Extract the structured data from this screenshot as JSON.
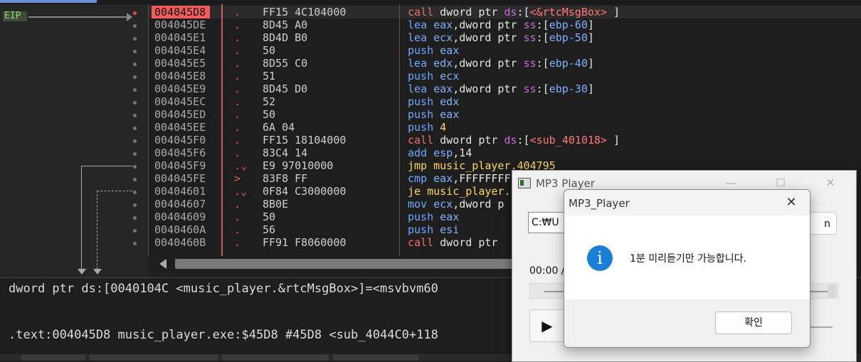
{
  "debugger": {
    "eip_label": "EIP",
    "rows": [
      {
        "addr": "004045D8",
        "mark": ".",
        "bytes": "FF15 4C104000",
        "mn": "call",
        "ops": [
          {
            "t": "dword ptr ",
            "c": "op"
          },
          {
            "t": "ds",
            "c": "seg"
          },
          {
            "t": ":[",
            "c": "op"
          },
          {
            "t": "<&rtcMsgBox>",
            "c": "tgt"
          },
          {
            "t": " ]",
            "c": "op"
          }
        ]
      },
      {
        "addr": "004045DE",
        "mark": ".",
        "bytes": "8D45 A0",
        "mn": "lea",
        "ops": [
          {
            "t": "eax",
            "c": "reg"
          },
          {
            "t": ",dword ptr ",
            "c": "op"
          },
          {
            "t": "ss",
            "c": "seg"
          },
          {
            "t": ":[",
            "c": "op"
          },
          {
            "t": "ebp-60",
            "c": "reg"
          },
          {
            "t": "]",
            "c": "op"
          }
        ]
      },
      {
        "addr": "004045E1",
        "mark": ".",
        "bytes": "8D4D B0",
        "mn": "lea",
        "ops": [
          {
            "t": "ecx",
            "c": "reg"
          },
          {
            "t": ",dword ptr ",
            "c": "op"
          },
          {
            "t": "ss",
            "c": "seg"
          },
          {
            "t": ":[",
            "c": "op"
          },
          {
            "t": "ebp-50",
            "c": "reg"
          },
          {
            "t": "]",
            "c": "op"
          }
        ]
      },
      {
        "addr": "004045E4",
        "mark": ".",
        "bytes": "50",
        "mn": "push",
        "ops": [
          {
            "t": "eax",
            "c": "reg"
          }
        ]
      },
      {
        "addr": "004045E5",
        "mark": ".",
        "bytes": "8D55 C0",
        "mn": "lea",
        "ops": [
          {
            "t": "edx",
            "c": "reg"
          },
          {
            "t": ",dword ptr ",
            "c": "op"
          },
          {
            "t": "ss",
            "c": "seg"
          },
          {
            "t": ":[",
            "c": "op"
          },
          {
            "t": "ebp-40",
            "c": "reg"
          },
          {
            "t": "]",
            "c": "op"
          }
        ]
      },
      {
        "addr": "004045E8",
        "mark": ".",
        "bytes": "51",
        "mn": "push",
        "ops": [
          {
            "t": "ecx",
            "c": "reg"
          }
        ]
      },
      {
        "addr": "004045E9",
        "mark": ".",
        "bytes": "8D45 D0",
        "mn": "lea",
        "ops": [
          {
            "t": "eax",
            "c": "reg"
          },
          {
            "t": ",dword ptr ",
            "c": "op"
          },
          {
            "t": "ss",
            "c": "seg"
          },
          {
            "t": ":[",
            "c": "op"
          },
          {
            "t": "ebp-30",
            "c": "reg"
          },
          {
            "t": "]",
            "c": "op"
          }
        ]
      },
      {
        "addr": "004045EC",
        "mark": ".",
        "bytes": "52",
        "mn": "push",
        "ops": [
          {
            "t": "edx",
            "c": "reg"
          }
        ]
      },
      {
        "addr": "004045ED",
        "mark": ".",
        "bytes": "50",
        "mn": "push",
        "ops": [
          {
            "t": "eax",
            "c": "reg"
          }
        ]
      },
      {
        "addr": "004045EE",
        "mark": ".",
        "bytes": "6A 04",
        "mn": "push",
        "ops": [
          {
            "t": "4",
            "c": "jmpc"
          }
        ]
      },
      {
        "addr": "004045F0",
        "mark": ".",
        "bytes": "FF15 18104000",
        "mn": "call",
        "ops": [
          {
            "t": "dword ptr ",
            "c": "op"
          },
          {
            "t": "ds",
            "c": "seg"
          },
          {
            "t": ":[",
            "c": "op"
          },
          {
            "t": "<sub_401018>",
            "c": "tgt"
          },
          {
            "t": " ]",
            "c": "op"
          }
        ]
      },
      {
        "addr": "004045F6",
        "mark": ".",
        "bytes": "83C4 14",
        "mn": "add",
        "ops": [
          {
            "t": "esp",
            "c": "reg"
          },
          {
            "t": ",14",
            "c": "op"
          }
        ]
      },
      {
        "addr": "004045F9",
        "mark": ".⌄",
        "bytes": "E9 97010000",
        "mn": "jmp",
        "ops": [
          {
            "t": "music_player.404795",
            "c": "jmpc"
          }
        ]
      },
      {
        "addr": "004045FE",
        "mark": ">",
        "bytes": "83F8 FF",
        "mn": "cmp",
        "ops": [
          {
            "t": "eax",
            "c": "reg"
          },
          {
            "t": ",FFFFFFFF",
            "c": "op"
          }
        ]
      },
      {
        "addr": "00404601",
        "mark": ".⌄",
        "bytes": "0F84 C3000000",
        "mn": "je",
        "ops": [
          {
            "t": "music_player.",
            "c": "jmpc"
          }
        ]
      },
      {
        "addr": "00404607",
        "mark": ".",
        "bytes": "8B0E",
        "mn": "mov",
        "ops": [
          {
            "t": "ecx",
            "c": "reg"
          },
          {
            "t": ",dword p",
            "c": "op"
          }
        ]
      },
      {
        "addr": "00404609",
        "mark": ".",
        "bytes": "50",
        "mn": "push",
        "ops": [
          {
            "t": "eax",
            "c": "reg"
          }
        ]
      },
      {
        "addr": "0040460A",
        "mark": ".",
        "bytes": "56",
        "mn": "push",
        "ops": [
          {
            "t": "esi",
            "c": "reg"
          }
        ]
      },
      {
        "addr": "0040460B",
        "mark": ".",
        "bytes": "FF91 F8060000",
        "mn": "call",
        "ops": [
          {
            "t": "dword ptr",
            "c": "op"
          }
        ]
      }
    ],
    "info_line1": "dword ptr ds:[0040104C <music_player.&rtcMsgBox>]=<msvbvm60",
    "info_line2": ".text:004045D8 music_player.exe:$45D8 #45D8 <sub_4044C0+118"
  },
  "mp3_window": {
    "title": "MP3 Player",
    "path_value": "C:₩U",
    "browse_label": "n",
    "time_text": "00:00 /",
    "play_icon": "▶",
    "minimize_icon": "—",
    "maximize_icon": "☐",
    "close_icon": "✕"
  },
  "msgbox": {
    "title": "MP3_Player",
    "close_icon": "✕",
    "info_icon": "i",
    "message": "1분 미리듣기만 가능합니다.",
    "ok_label": "확인"
  }
}
